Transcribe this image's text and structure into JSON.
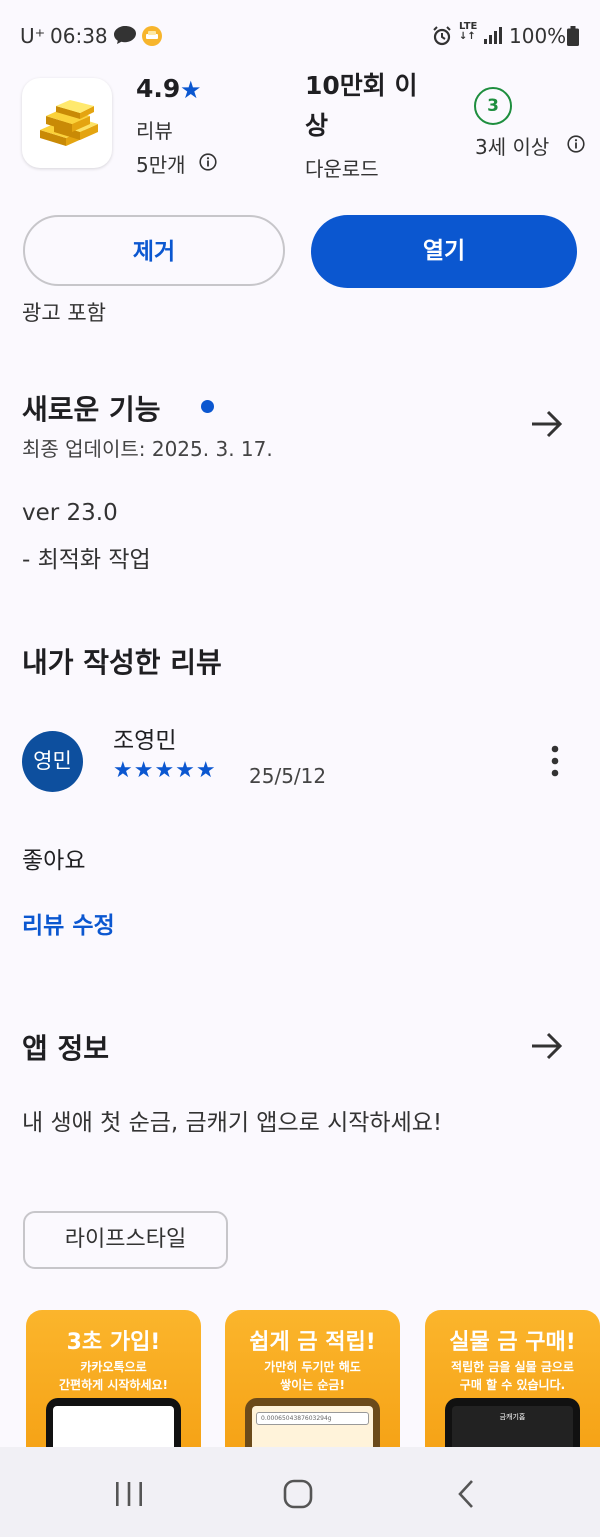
{
  "status_bar": {
    "carrier": "U⁺",
    "time": "06:38",
    "network": "LTE",
    "battery": "100%",
    "icons": [
      "chat-icon",
      "notification-app-icon",
      "alarm-icon",
      "lte-icon",
      "signal-icon",
      "battery-icon"
    ]
  },
  "app": {
    "icon": "gold-bars-icon",
    "rating": "4.9",
    "rating_star": "★",
    "reviews_label": "리뷰",
    "reviews_count": "5만개",
    "downloads_value": "10만회 이상",
    "downloads_label": "다운로드",
    "age_rating": "3",
    "age_label": "3세 이상"
  },
  "actions": {
    "remove_label": "제거",
    "open_label": "열기",
    "ads_notice": "광고 포함"
  },
  "whats_new": {
    "title": "새로운 기능",
    "last_updated": "최종 업데이트: 2025. 3. 17.",
    "notes": [
      "ver 23.0",
      "- 최적화 작업"
    ]
  },
  "my_review": {
    "title": "내가 작성한 리뷰",
    "avatar_text": "영민",
    "reviewer": "조영민",
    "stars": "★★★★★",
    "rating": 5,
    "date": "25/5/12",
    "text": "좋아요",
    "edit_label": "리뷰 수정"
  },
  "app_info": {
    "title": "앱 정보",
    "description": "내 생애 첫 순금, 금캐기 앱으로 시작하세요!",
    "category_chip": "라이프스타일"
  },
  "screenshots": [
    {
      "title": "3초 가입!",
      "sub1": "카카오톡으로",
      "sub2": "간편하게 시작하세요!"
    },
    {
      "title": "쉽게 금 적립!",
      "sub1": "가만히 두기만 해도",
      "sub2": "쌓이는 순금!",
      "screen_text": "0.0006504387603294g"
    },
    {
      "title": "실물 금 구매!",
      "sub1": "적립한 금을 실물 금으로",
      "sub2": "구매 할 수 있습니다.",
      "screen_text": "금캐기홈"
    }
  ],
  "nav_bar": {
    "icons": [
      "recents-icon",
      "home-icon",
      "back-icon"
    ]
  },
  "colors": {
    "accent": "#0b57d0",
    "background": "#fbf9fe",
    "age_badge": "#1e8e3e",
    "avatar": "#0d4f9e",
    "screenshot_orange": "#f5a013"
  }
}
